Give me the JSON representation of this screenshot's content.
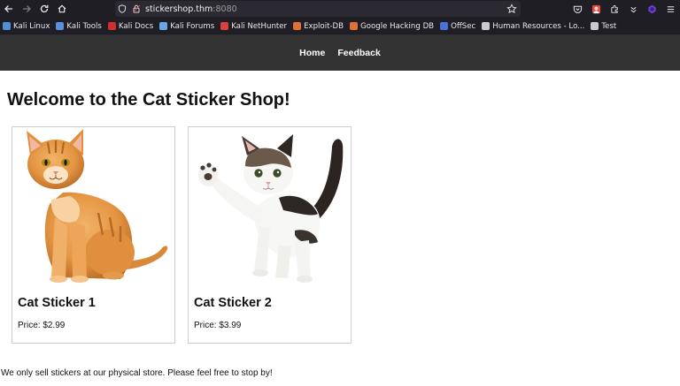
{
  "browser": {
    "url_host": "stickershop.thm",
    "url_port": ":8080",
    "bookmarks": [
      {
        "label": "Kali Linux",
        "icon": "kali-dragon-icon",
        "color": "#4f8fd6"
      },
      {
        "label": "Kali Tools",
        "icon": "kali-tools-icon",
        "color": "#5b8fe0"
      },
      {
        "label": "Kali Docs",
        "icon": "kali-docs-icon",
        "color": "#d12f2f"
      },
      {
        "label": "Kali Forums",
        "icon": "kali-forums-icon",
        "color": "#6aa7e8"
      },
      {
        "label": "Kali NetHunter",
        "icon": "nethunter-icon",
        "color": "#d9413c"
      },
      {
        "label": "Exploit-DB",
        "icon": "exploit-db-icon",
        "color": "#e0703a"
      },
      {
        "label": "Google Hacking DB",
        "icon": "ghdb-icon",
        "color": "#e0703a"
      },
      {
        "label": "OffSec",
        "icon": "offsec-icon",
        "color": "#4d6fd8"
      },
      {
        "label": "Human Resources - Lo...",
        "icon": "wordpress-icon",
        "color": "#c9cbd1"
      },
      {
        "label": "Test",
        "icon": "globe-icon",
        "color": "#c9cbd1"
      }
    ]
  },
  "site": {
    "nav": [
      "Home",
      "Feedback"
    ],
    "title": "Welcome to the Cat Sticker Shop!",
    "products": [
      {
        "name": "Cat Sticker 1",
        "price": "Price: $2.99"
      },
      {
        "name": "Cat Sticker 2",
        "price": "Price: $3.99"
      }
    ],
    "footer": "We only sell stickers at our physical store. Please feel free to stop by!"
  }
}
